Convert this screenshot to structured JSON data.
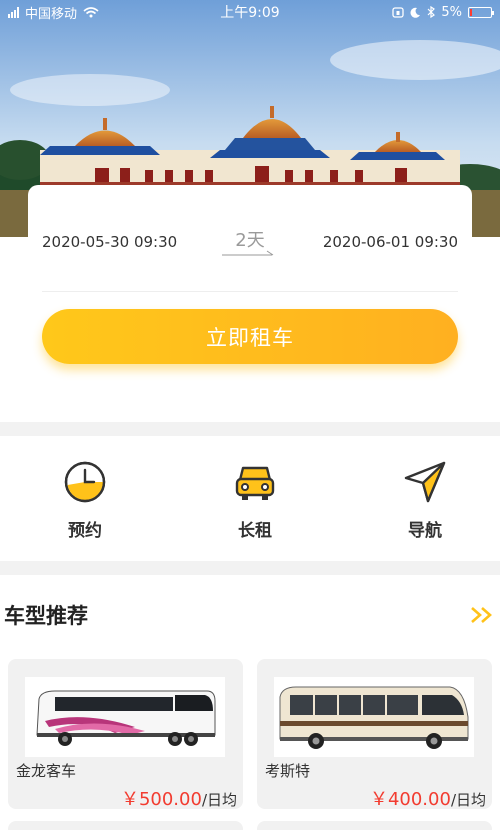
{
  "status_bar": {
    "carrier": "中国移动",
    "time": "上午9:09",
    "battery_percent": 5,
    "battery_label": "5%"
  },
  "booking": {
    "start_datetime": "2020-05-30 09:30",
    "duration": "2天",
    "end_datetime": "2020-06-01 09:30",
    "rent_button": "立即租车"
  },
  "quick_menu": {
    "items": [
      {
        "label": "预约",
        "icon": "clock-icon"
      },
      {
        "label": "长租",
        "icon": "car-icon"
      },
      {
        "label": "导航",
        "icon": "navigation-icon"
      }
    ]
  },
  "recommendations": {
    "title": "车型推荐",
    "more_icon": "double-chevron-right-icon",
    "cars": [
      {
        "name": "金龙客车",
        "price": "￥500.00",
        "unit": "/日均"
      },
      {
        "name": "考斯特",
        "price": "￥400.00",
        "unit": "/日均"
      }
    ]
  },
  "colors": {
    "accent": "#ffc21a",
    "price": "#f23c30",
    "icon_outline": "#333333"
  }
}
